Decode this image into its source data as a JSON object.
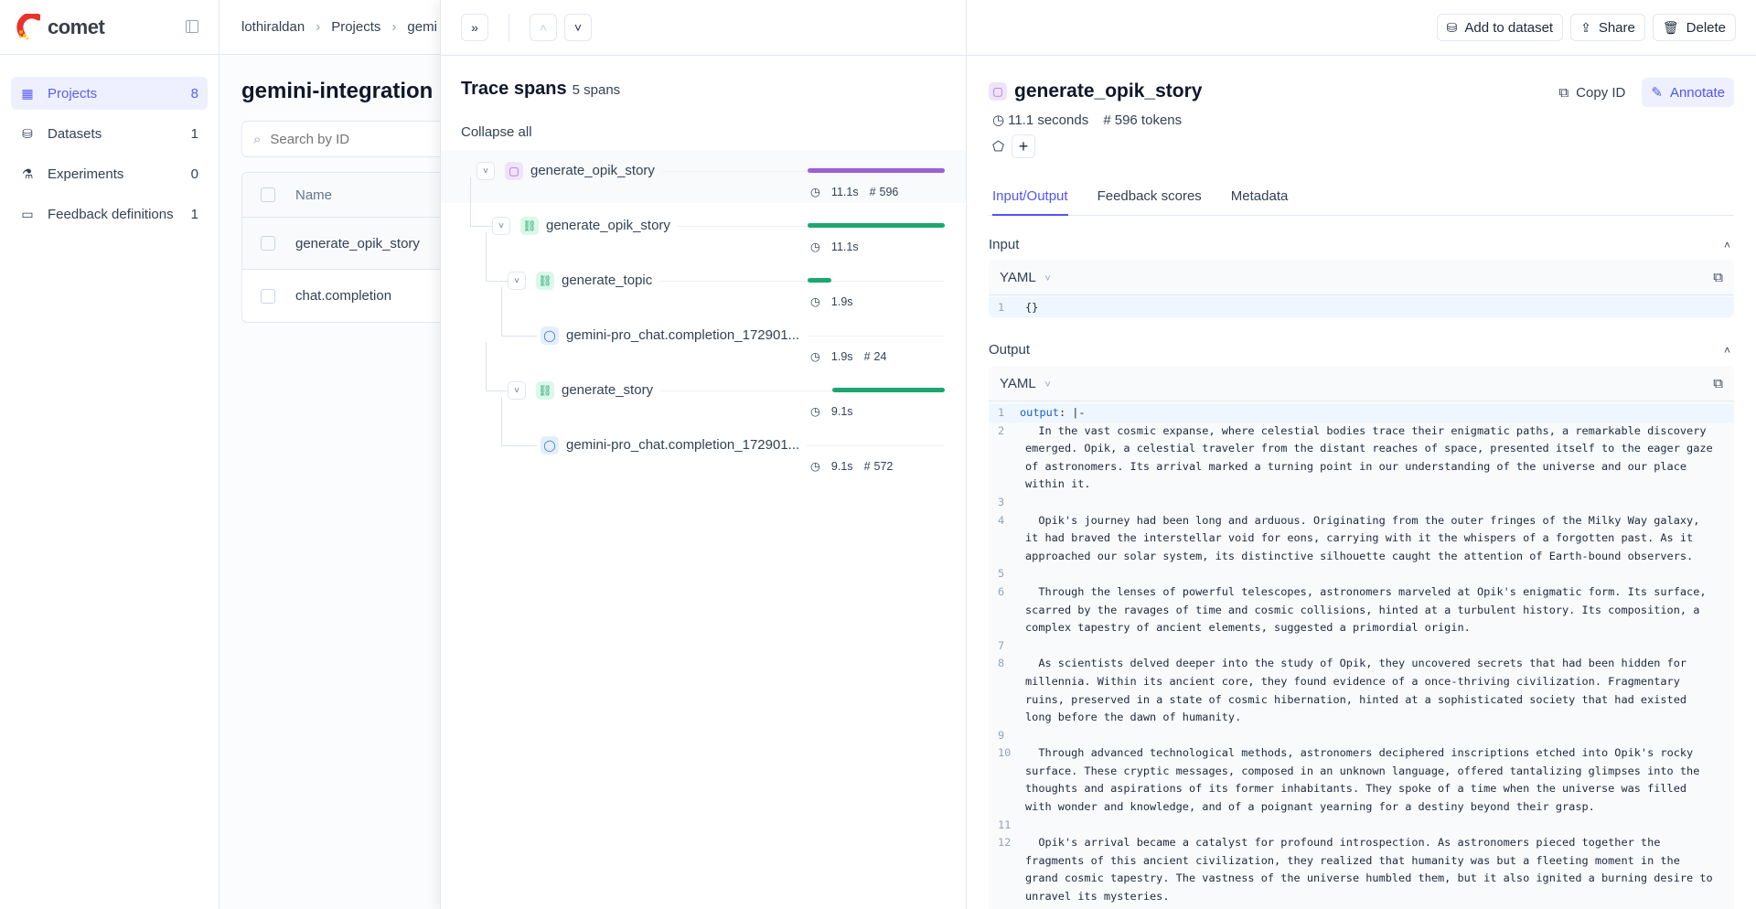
{
  "app": {
    "logo_text": "comet"
  },
  "sidebar": {
    "items": [
      {
        "label": "Projects",
        "count": "8",
        "icon": "grid-icon",
        "active": true
      },
      {
        "label": "Datasets",
        "count": "1",
        "icon": "database-icon"
      },
      {
        "label": "Experiments",
        "count": "0",
        "icon": "flask-icon"
      },
      {
        "label": "Feedback definitions",
        "count": "1",
        "icon": "message-square-icon"
      }
    ]
  },
  "breadcrumb": [
    "lothiraldan",
    "Projects",
    "gemi"
  ],
  "project": {
    "title": "gemini-integration",
    "search_placeholder": "Search by ID",
    "table": {
      "header": "Name",
      "rows": [
        "generate_opik_story",
        "chat.completion"
      ]
    }
  },
  "trace_panel": {
    "title": "Trace spans",
    "count_label": "5 spans",
    "collapse_all": "Collapse all",
    "spans": [
      {
        "name": "generate_opik_story",
        "type": "trace",
        "duration": "11.1s",
        "tokens": "596",
        "timeline": {
          "start": 0.0,
          "length": 1.0
        },
        "color": "#9b5fd9"
      },
      {
        "name": "generate_opik_story",
        "type": "general",
        "duration": "11.1s",
        "timeline": {
          "start": 0.0,
          "length": 1.0
        },
        "color": "#1ea672"
      },
      {
        "name": "generate_topic",
        "type": "general",
        "duration": "1.9s",
        "timeline": {
          "start": 0.0,
          "length": 0.17
        },
        "color": "#1ea672"
      },
      {
        "name": "gemini-pro_chat.completion_172901...",
        "type": "llm",
        "duration": "1.9s",
        "tokens": "24"
      },
      {
        "name": "generate_story",
        "type": "general",
        "duration": "9.1s",
        "timeline": {
          "start": 0.18,
          "length": 0.82
        },
        "color": "#1ea672"
      },
      {
        "name": "gemini-pro_chat.completion_172901...",
        "type": "llm",
        "duration": "9.1s",
        "tokens": "572"
      }
    ]
  },
  "toolbar": {
    "add_to_dataset": "Add to dataset",
    "share": "Share",
    "delete": "Delete"
  },
  "detail": {
    "title": "generate_opik_story",
    "duration": "11.1 seconds",
    "tokens": "596 tokens",
    "copy_id": "Copy ID",
    "annotate": "Annotate",
    "tabs": [
      "Input/Output",
      "Feedback scores",
      "Metadata"
    ],
    "input": {
      "label": "Input",
      "format": "YAML",
      "lines": [
        "{}"
      ]
    },
    "output": {
      "label": "Output",
      "format": "YAML",
      "key": "output",
      "key_suffix": ": |-",
      "lines": [
        "  In the vast cosmic expanse, where celestial bodies trace their enigmatic paths, a remarkable discovery emerged. Opik, a celestial traveler from the distant reaches of space, presented itself to the eager gaze of astronomers. Its arrival marked a turning point in our understanding of the universe and our place within it.",
        "",
        "  Opik's journey had been long and arduous. Originating from the outer fringes of the Milky Way galaxy, it had braved the interstellar void for eons, carrying with it the whispers of a forgotten past. As it approached our solar system, its distinctive silhouette caught the attention of Earth-bound observers.",
        "",
        "  Through the lenses of powerful telescopes, astronomers marveled at Opik's enigmatic form. Its surface, scarred by the ravages of time and cosmic collisions, hinted at a turbulent history. Its composition, a complex tapestry of ancient elements, suggested a primordial origin.",
        "",
        "  As scientists delved deeper into the study of Opik, they uncovered secrets that had been hidden for millennia. Within its ancient core, they found evidence of a once-thriving civilization. Fragmentary ruins, preserved in a state of cosmic hibernation, hinted at a sophisticated society that had existed long before the dawn of humanity.",
        "",
        "  Through advanced technological methods, astronomers deciphered inscriptions etched into Opik's rocky surface. These cryptic messages, composed in an unknown language, offered tantalizing glimpses into the thoughts and aspirations of its former inhabitants. They spoke of a time when the universe was filled with wonder and knowledge, and of a poignant yearning for a destiny beyond their grasp.",
        "",
        "  Opik's arrival became a catalyst for profound introspection. As astronomers pieced together the fragments of this ancient civilization, they realized that humanity was but a fleeting moment in the grand cosmic tapestry. The vastness of the universe humbled them, but it also ignited a burning desire to unravel its mysteries."
      ]
    }
  },
  "colors": {
    "accent": "#5155f5",
    "trace": "#9b5fd9",
    "span": "#1ea672"
  }
}
